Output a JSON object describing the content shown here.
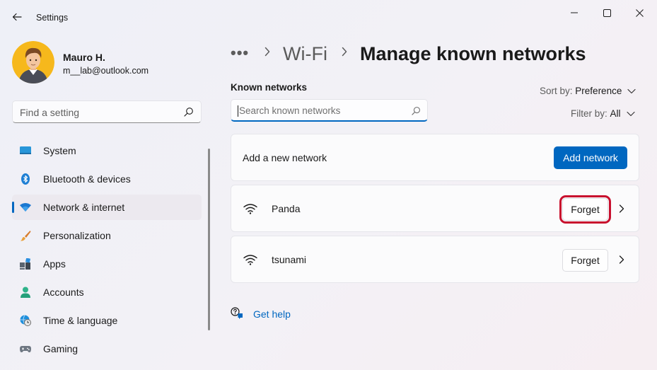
{
  "window": {
    "title": "Settings"
  },
  "user": {
    "name": "Mauro H.",
    "email": "m__lab@outlook.com"
  },
  "sidebar": {
    "search_placeholder": "Find a setting",
    "items": [
      {
        "label": "System",
        "icon": "monitor-icon"
      },
      {
        "label": "Bluetooth & devices",
        "icon": "bluetooth-icon"
      },
      {
        "label": "Network & internet",
        "icon": "wifi-icon",
        "active": true
      },
      {
        "label": "Personalization",
        "icon": "brush-icon"
      },
      {
        "label": "Apps",
        "icon": "apps-icon"
      },
      {
        "label": "Accounts",
        "icon": "person-icon"
      },
      {
        "label": "Time & language",
        "icon": "globe-clock-icon"
      },
      {
        "label": "Gaming",
        "icon": "gamepad-icon"
      }
    ]
  },
  "breadcrumb": {
    "more": "•••",
    "parent": "Wi-Fi",
    "current": "Manage known networks"
  },
  "known": {
    "label": "Known networks",
    "search_placeholder": "Search known networks",
    "sort_label": "Sort by:",
    "sort_value": "Preference",
    "filter_label": "Filter by:",
    "filter_value": "All"
  },
  "add_card": {
    "label": "Add a new network",
    "button": "Add network"
  },
  "networks": [
    {
      "name": "Panda",
      "forget_label": "Forget",
      "highlighted": true
    },
    {
      "name": "tsunami",
      "forget_label": "Forget",
      "highlighted": false
    }
  ],
  "help": {
    "label": "Get help"
  },
  "colors": {
    "accent": "#0067c0",
    "highlight": "#c8102e"
  }
}
